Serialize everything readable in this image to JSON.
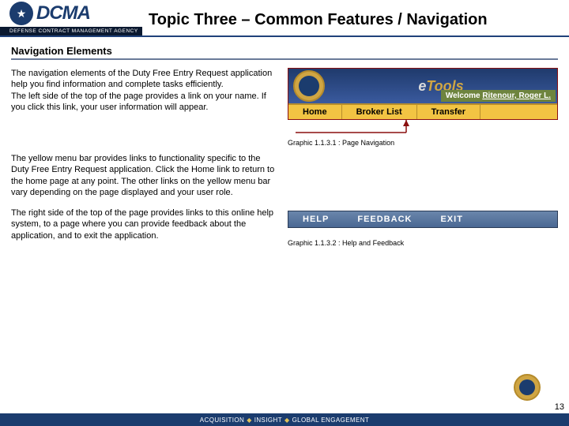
{
  "header": {
    "logo_text": "DCMA",
    "logo_strip": "DEFENSE CONTRACT MANAGEMENT AGENCY",
    "title": "Topic Three – Common Features / Navigation"
  },
  "section": {
    "heading": "Navigation Elements",
    "para1": "The navigation elements of the Duty Free Entry Request application help you find information and complete tasks efficiently.",
    "para1b": "The left side of the top of the page provides a link on your name. If you click this link, your user information will appear.",
    "para2": "The yellow menu bar provides links to functionality specific to the Duty Free Entry Request application. Click the Home link to return to the home page at any point. The other links on the yellow menu bar vary depending on the page displayed and your user role.",
    "para3": "The right side of the top of the page provides links to this online help system, to a page where you can provide feedback about the application, and to exit the application."
  },
  "graphic1": {
    "etools_prefix": "e",
    "etools_label": "Tools",
    "welcome_label": "Welcome ",
    "welcome_user": "Ritenour, Roger L.",
    "menu": {
      "home": "Home",
      "broker": "Broker List",
      "transfer": "Transfer"
    },
    "caption": "Graphic 1.1.3.1 : Page Navigation"
  },
  "graphic2": {
    "help": "HELP",
    "feedback": "FEEDBACK",
    "exit": "EXIT",
    "caption": "Graphic 1.1.3.2 : Help and Feedback"
  },
  "footer": {
    "a": "ACQUISITION",
    "b": "INSIGHT",
    "c": "GLOBAL ENGAGEMENT",
    "page": "13"
  }
}
